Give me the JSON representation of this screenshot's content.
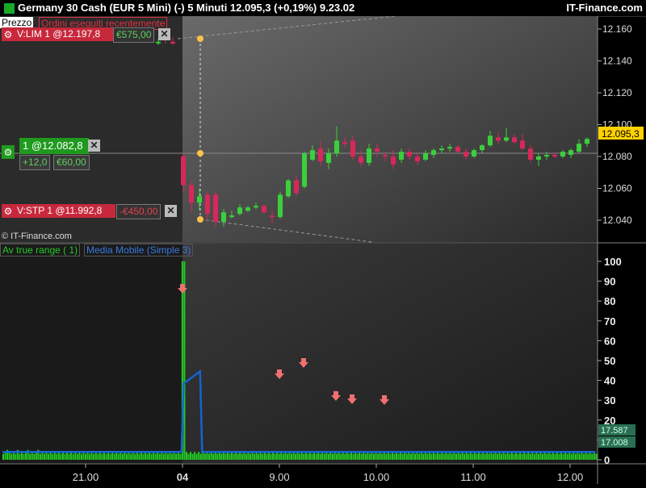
{
  "title": "Germany 30 Cash (EUR 5 Mini) (-)   5 Minuti     12.095,3 (+0,19%)     9.23.02",
  "brand": "IT-Finance.com",
  "price_pane": {
    "label": "Prezzo",
    "orders_label": "Ordini eseguiti recentemente",
    "current_price": "12.095,3",
    "y_ticks": [
      "12.160",
      "12.140",
      "12.120",
      "12.100",
      "12.080",
      "12.060",
      "12.040"
    ],
    "y_tick_values": [
      12160,
      12140,
      12120,
      12100,
      12080,
      12060,
      12040
    ],
    "watermark": "© IT-Finance.com",
    "limit_order": {
      "label": "V:LIM 1 @12.197,8",
      "value": "€575,00"
    },
    "position": {
      "label": "1 @12.082,8",
      "pnl_points": "+12,0",
      "pnl_eur": "€60,00"
    },
    "stop_order": {
      "label": "V:STP 1 @11.992,8",
      "value": "-€450,00"
    }
  },
  "indicator_pane": {
    "label_atr": "Av true range ( 1)",
    "label_ma": "Media Mobile (Simple 3)",
    "y_ticks": [
      "100",
      "90",
      "80",
      "70",
      "60",
      "50",
      "40",
      "30",
      "20",
      "10",
      "0"
    ],
    "y_tick_values": [
      100,
      90,
      80,
      70,
      60,
      50,
      40,
      30,
      20,
      10,
      0
    ],
    "atr_value": "17.587",
    "ma_value": "17.008"
  },
  "x_axis": {
    "ticks": [
      "21.00",
      "04",
      "9.00",
      "10.00",
      "11.00",
      "12.00"
    ]
  },
  "colors": {
    "up": "#3ccf3c",
    "down": "#d8285a",
    "ma": "#1464d2",
    "atr": "#22cc22",
    "arrow": "#f07070",
    "price_tag": "#ffd200"
  },
  "chart_data": [
    {
      "type": "candlestick",
      "title": "Prezzo",
      "ylim": [
        12030,
        12170
      ],
      "candles": [
        {
          "o": 12152,
          "h": 12154,
          "l": 12150,
          "c": 12152
        },
        {
          "o": 12154,
          "h": 12156,
          "l": 12151,
          "c": 12153
        },
        {
          "o": 12152,
          "h": 12155,
          "l": 12150,
          "c": 12151
        },
        {
          "o": 12080,
          "h": 12082,
          "l": 12058,
          "c": 12062
        },
        {
          "o": 12062,
          "h": 12064,
          "l": 12045,
          "c": 12051
        },
        {
          "o": 12051,
          "h": 12060,
          "l": 12046,
          "c": 12055
        },
        {
          "o": 12056,
          "h": 12058,
          "l": 12040,
          "c": 12044
        },
        {
          "o": 12056,
          "h": 12058,
          "l": 12036,
          "c": 12039
        },
        {
          "o": 12039,
          "h": 12047,
          "l": 12036,
          "c": 12045
        },
        {
          "o": 12043,
          "h": 12046,
          "l": 12041,
          "c": 12043
        },
        {
          "o": 12044,
          "h": 12050,
          "l": 12043,
          "c": 12048
        },
        {
          "o": 12046,
          "h": 12049,
          "l": 12045,
          "c": 12048
        },
        {
          "o": 12048,
          "h": 12051,
          "l": 12047,
          "c": 12049
        },
        {
          "o": 12049,
          "h": 12050,
          "l": 12044,
          "c": 12045
        },
        {
          "o": 12043,
          "h": 12046,
          "l": 12038,
          "c": 12042
        },
        {
          "o": 12042,
          "h": 12058,
          "l": 12041,
          "c": 12056
        },
        {
          "o": 12055,
          "h": 12066,
          "l": 12054,
          "c": 12065
        },
        {
          "o": 12065,
          "h": 12068,
          "l": 12055,
          "c": 12057
        },
        {
          "o": 12061,
          "h": 12083,
          "l": 12060,
          "c": 12082
        },
        {
          "o": 12078,
          "h": 12087,
          "l": 12077,
          "c": 12084
        },
        {
          "o": 12085,
          "h": 12090,
          "l": 12074,
          "c": 12077
        },
        {
          "o": 12076,
          "h": 12085,
          "l": 12072,
          "c": 12082
        },
        {
          "o": 12082,
          "h": 12099,
          "l": 12080,
          "c": 12090
        },
        {
          "o": 12089,
          "h": 12092,
          "l": 12086,
          "c": 12088
        },
        {
          "o": 12090,
          "h": 12093,
          "l": 12078,
          "c": 12080
        },
        {
          "o": 12080,
          "h": 12084,
          "l": 12074,
          "c": 12076
        },
        {
          "o": 12076,
          "h": 12088,
          "l": 12074,
          "c": 12085
        },
        {
          "o": 12085,
          "h": 12088,
          "l": 12080,
          "c": 12083
        },
        {
          "o": 12081,
          "h": 12083,
          "l": 12077,
          "c": 12080
        },
        {
          "o": 12080,
          "h": 12084,
          "l": 12072,
          "c": 12075
        },
        {
          "o": 12078,
          "h": 12085,
          "l": 12076,
          "c": 12083
        },
        {
          "o": 12083,
          "h": 12085,
          "l": 12078,
          "c": 12080
        },
        {
          "o": 12080,
          "h": 12082,
          "l": 12075,
          "c": 12077
        },
        {
          "o": 12078,
          "h": 12084,
          "l": 12077,
          "c": 12082
        },
        {
          "o": 12081,
          "h": 12085,
          "l": 12079,
          "c": 12084
        },
        {
          "o": 12084,
          "h": 12087,
          "l": 12082,
          "c": 12085
        },
        {
          "o": 12085,
          "h": 12088,
          "l": 12083,
          "c": 12086
        },
        {
          "o": 12086,
          "h": 12087,
          "l": 12082,
          "c": 12083
        },
        {
          "o": 12083,
          "h": 12085,
          "l": 12078,
          "c": 12080
        },
        {
          "o": 12080,
          "h": 12085,
          "l": 12079,
          "c": 12084
        },
        {
          "o": 12084,
          "h": 12088,
          "l": 12082,
          "c": 12087
        },
        {
          "o": 12087,
          "h": 12096,
          "l": 12086,
          "c": 12093
        },
        {
          "o": 12092,
          "h": 12095,
          "l": 12088,
          "c": 12090
        },
        {
          "o": 12090,
          "h": 12098,
          "l": 12089,
          "c": 12092
        },
        {
          "o": 12092,
          "h": 12094,
          "l": 12088,
          "c": 12089
        },
        {
          "o": 12090,
          "h": 12094,
          "l": 12084,
          "c": 12085
        },
        {
          "o": 12085,
          "h": 12087,
          "l": 12076,
          "c": 12078
        },
        {
          "o": 12078,
          "h": 12082,
          "l": 12074,
          "c": 12080
        },
        {
          "o": 12080,
          "h": 12083,
          "l": 12078,
          "c": 12081
        },
        {
          "o": 12081,
          "h": 12083,
          "l": 12079,
          "c": 12080
        },
        {
          "o": 12080,
          "h": 12084,
          "l": 12079,
          "c": 12083
        },
        {
          "o": 12081,
          "h": 12085,
          "l": 12079,
          "c": 12084
        },
        {
          "o": 12083,
          "h": 12091,
          "l": 12082,
          "c": 12088
        },
        {
          "o": 12088,
          "h": 12092,
          "l": 12086,
          "c": 12091
        }
      ]
    },
    {
      "type": "bar",
      "title": "Av true range ( 1)",
      "ylim": [
        0,
        104
      ],
      "values": [
        3,
        4,
        5,
        4,
        3,
        4,
        3,
        5,
        3,
        4,
        3,
        4,
        5,
        3,
        4,
        3,
        4,
        5,
        3,
        4,
        3,
        4,
        3,
        4,
        3,
        4,
        3,
        4,
        3,
        4,
        3,
        4,
        3,
        4,
        3,
        4,
        3,
        4,
        3,
        4,
        3,
        4,
        3,
        4,
        3,
        4,
        3,
        4,
        3,
        4,
        3,
        4,
        3,
        4,
        3,
        4,
        3,
        4,
        3,
        4,
        3,
        4,
        3,
        4,
        3,
        4,
        3,
        4,
        3,
        4,
        3,
        4,
        3,
        4,
        3,
        4,
        3,
        4,
        3,
        4,
        3,
        4,
        3,
        4,
        3,
        4,
        3,
        4,
        3,
        4,
        3,
        4,
        3,
        4,
        3,
        4,
        3,
        4,
        3,
        4,
        3,
        4,
        3,
        4,
        3,
        4,
        3,
        4,
        3,
        4,
        3,
        4,
        3,
        4,
        3,
        4,
        3,
        4,
        3,
        4,
        3,
        4,
        3,
        4,
        3,
        4,
        3,
        4,
        3,
        4,
        3,
        4,
        3,
        4,
        3,
        4,
        3,
        4,
        3,
        4,
        3,
        4,
        3,
        4,
        3,
        4,
        3,
        4,
        3,
        4,
        3,
        4,
        3,
        4,
        3,
        4,
        3,
        4,
        3,
        4,
        3,
        4,
        3,
        4,
        3,
        4,
        3,
        4,
        3,
        4,
        3,
        4,
        3,
        4,
        3,
        4,
        3,
        4,
        3,
        4,
        3,
        4,
        3,
        4,
        3,
        4,
        3,
        4,
        3,
        4,
        3,
        4,
        3,
        4,
        3,
        4,
        3,
        4,
        3,
        4,
        3,
        4,
        3,
        4,
        3,
        4,
        3,
        4,
        3,
        4,
        3,
        4,
        3,
        4,
        3,
        4,
        3,
        4,
        3,
        4,
        3,
        4,
        3,
        4,
        3,
        4,
        3,
        4,
        3,
        4,
        3,
        4,
        3,
        4,
        3,
        4,
        3,
        4,
        3,
        4,
        3,
        4,
        3,
        4,
        3,
        4,
        3,
        4,
        3,
        4,
        3,
        4,
        3,
        4,
        3,
        4,
        3,
        4,
        3,
        4,
        3,
        4,
        3,
        4,
        3,
        4,
        3,
        4,
        3,
        4,
        3,
        4,
        3,
        4,
        3,
        4,
        3,
        4,
        3,
        4,
        3,
        4,
        3,
        4,
        3,
        4,
        3,
        4,
        3,
        4,
        3,
        4,
        3,
        4,
        3,
        4,
        3,
        4,
        3,
        4,
        3,
        4
      ],
      "ma_values": [
        4,
        4,
        4,
        4,
        4,
        4,
        4,
        4,
        4,
        4,
        4,
        4,
        4,
        4,
        4,
        4,
        4,
        4,
        4,
        4,
        4,
        4,
        4,
        4,
        4,
        4,
        4,
        4,
        4,
        4,
        4,
        4,
        4,
        4,
        4,
        4,
        4,
        4,
        4,
        4,
        4,
        4,
        4,
        4,
        4,
        4,
        4,
        4,
        4,
        4,
        4,
        4,
        4,
        4,
        4,
        4,
        4,
        4,
        4,
        4,
        4,
        4,
        4,
        4,
        4,
        4,
        4,
        4,
        4,
        4,
        4,
        4,
        4,
        4,
        4,
        4,
        4,
        4,
        4,
        4,
        4,
        4,
        4,
        4,
        4,
        4,
        4,
        4,
        4,
        4,
        4,
        4,
        4,
        4,
        4,
        4,
        4,
        4,
        4,
        4,
        4,
        4,
        4,
        4,
        4,
        4,
        4,
        4,
        4,
        4,
        4,
        4,
        4,
        4,
        4,
        4,
        4,
        4,
        4,
        4,
        4,
        4,
        4,
        4,
        4,
        4,
        4,
        4,
        4,
        4,
        4,
        4,
        4,
        4,
        4,
        4,
        4,
        4,
        4,
        4,
        4,
        4,
        4,
        4,
        4,
        4,
        4,
        4,
        4,
        4,
        4,
        4,
        4,
        4,
        4,
        4,
        4,
        4,
        4,
        4,
        4,
        4,
        4,
        4,
        4,
        4,
        4,
        4,
        4,
        4,
        4,
        4,
        4,
        4,
        4,
        4,
        4,
        4,
        4,
        4,
        4,
        4,
        4,
        4,
        4,
        4,
        4,
        4,
        4,
        4,
        4,
        4,
        4,
        4,
        4,
        4,
        4,
        4,
        4,
        4,
        4,
        4,
        4,
        4,
        4,
        4,
        4,
        4,
        4,
        4,
        4,
        4,
        4,
        4,
        4,
        4,
        4,
        4,
        4,
        4,
        4,
        4,
        4,
        4,
        4,
        4,
        4,
        4,
        4,
        4,
        4,
        4,
        4,
        4,
        4,
        4,
        4,
        4,
        4,
        4,
        4,
        4,
        4,
        4,
        4,
        4,
        4,
        4,
        4,
        4,
        4,
        4,
        4,
        4,
        4,
        4,
        4,
        4,
        4,
        4,
        4,
        4,
        4,
        4,
        4,
        4,
        4,
        4,
        4,
        4,
        4,
        4,
        4,
        4,
        4,
        4,
        4,
        4,
        4,
        4,
        4,
        4,
        4,
        4,
        4,
        4,
        4,
        4,
        4,
        4,
        4,
        4,
        4,
        4,
        4,
        4,
        4,
        4,
        4,
        4,
        4,
        4,
        4
      ]
    }
  ]
}
